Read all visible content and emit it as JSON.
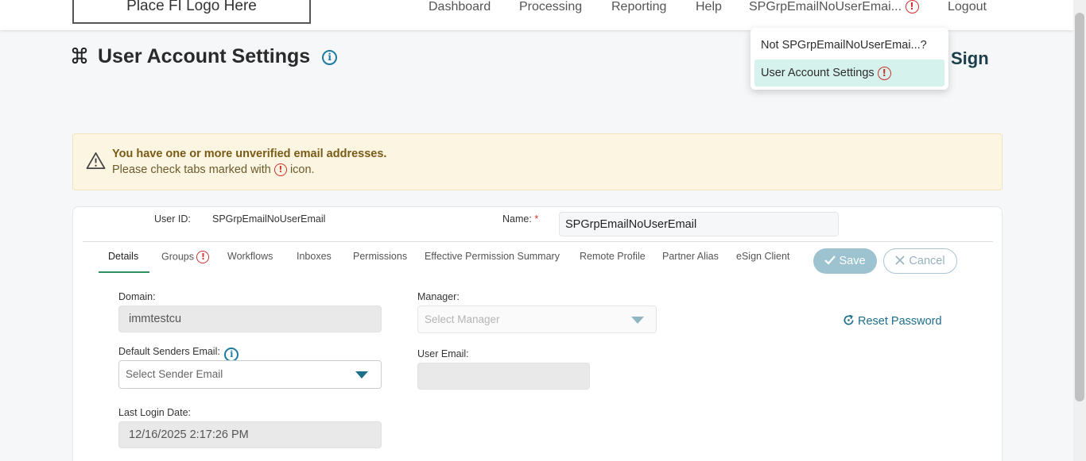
{
  "header": {
    "logo_text": "Place FI Logo Here",
    "nav": {
      "dashboard": "Dashboard",
      "processing": "Processing",
      "reporting": "Reporting",
      "help": "Help",
      "user_name": "SPGrpEmailNoUserEmai...",
      "logout": "Logout"
    }
  },
  "user_menu": {
    "not_user": "Not SPGrpEmailNoUserEmai...?",
    "account_settings": "User Account Settings"
  },
  "page": {
    "title": "User Account Settings",
    "right_heading_fragment": "Sign"
  },
  "warning": {
    "line1": "You have one or more unverified email addresses.",
    "line2_prefix": "Please check tabs marked with",
    "line2_suffix": "icon."
  },
  "user": {
    "user_id_label": "User ID:",
    "user_id_value": "SPGrpEmailNoUserEmail",
    "name_label": "Name:",
    "name_required_mark": "*",
    "name_value": "SPGrpEmailNoUserEmail"
  },
  "tabs": [
    {
      "label": "Details"
    },
    {
      "label": "Groups"
    },
    {
      "label": "Workflows"
    },
    {
      "label": "Inboxes"
    },
    {
      "label": "Permissions"
    },
    {
      "label": "Effective Permission Summary"
    },
    {
      "label": "Remote Profile"
    },
    {
      "label": "Partner Alias"
    },
    {
      "label": "eSign Client"
    }
  ],
  "actions": {
    "save": "Save",
    "cancel": "Cancel",
    "reset_password": "Reset Password"
  },
  "details": {
    "domain_label": "Domain:",
    "domain_value": "immtestcu",
    "default_sender_label": "Default Senders Email:",
    "default_sender_placeholder": "Select Sender Email",
    "last_login_label": "Last Login Date:",
    "last_login_value": "12/16/2025 2:17:26 PM",
    "manager_label": "Manager:",
    "manager_placeholder": "Select Manager",
    "user_email_label": "User Email:",
    "user_email_value": ""
  },
  "colors": {
    "accent": "#2f8f63",
    "link": "#1f6e8c",
    "alert": "#d0312d",
    "warning_bg": "#fbf5e2",
    "save_bg": "#9dc3d0",
    "menu_active_bg": "#d5f2ec"
  },
  "icons": {
    "title_icon": "command-icon",
    "info": "info-circle-icon",
    "alert": "exclamation-circle-icon",
    "warning": "warning-triangle-icon",
    "check": "check-icon",
    "close": "close-icon",
    "reset": "refresh-icon",
    "caret": "chevron-down-icon"
  }
}
